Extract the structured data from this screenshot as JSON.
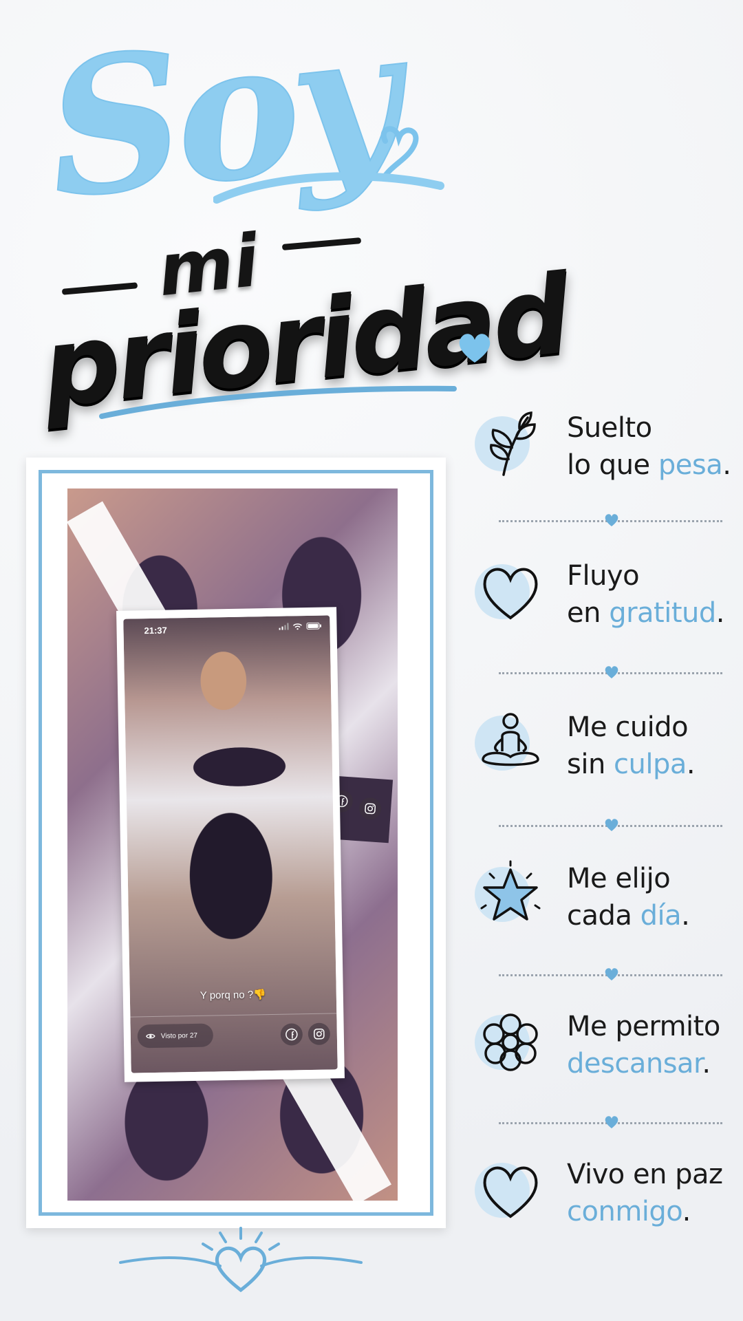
{
  "title": {
    "word1": "Soy",
    "word2": "mi",
    "word3": "prioridad"
  },
  "photo": {
    "status_time": "21:37",
    "caption": "Y porq no ?👎",
    "views": "Visto por 27"
  },
  "affirmations": [
    {
      "icon": "leaf-icon",
      "line1": "Suelto",
      "line2_pre": "lo que ",
      "accent": "pesa",
      "line2_post": "."
    },
    {
      "icon": "heart-icon",
      "line1": "Fluyo",
      "line2_pre": "en ",
      "accent": "gratitud",
      "line2_post": "."
    },
    {
      "icon": "meditation-icon",
      "line1": "Me cuido",
      "line2_pre": "sin ",
      "accent": "culpa",
      "line2_post": "."
    },
    {
      "icon": "star-icon",
      "line1": "Me elijo",
      "line2_pre": "cada ",
      "accent": "día",
      "line2_post": "."
    },
    {
      "icon": "flower-icon",
      "line1": "Me permito",
      "line2_pre": "",
      "accent": "descansar",
      "line2_post": "."
    },
    {
      "icon": "heart-icon",
      "line1": "Vivo en paz",
      "line2_pre": "",
      "accent": "conmigo",
      "line2_post": "."
    }
  ],
  "colors": {
    "accent": "#6aaed9",
    "title_blue": "#8ecdf0",
    "dark": "#151515",
    "frame_border": "#7db8dd"
  }
}
